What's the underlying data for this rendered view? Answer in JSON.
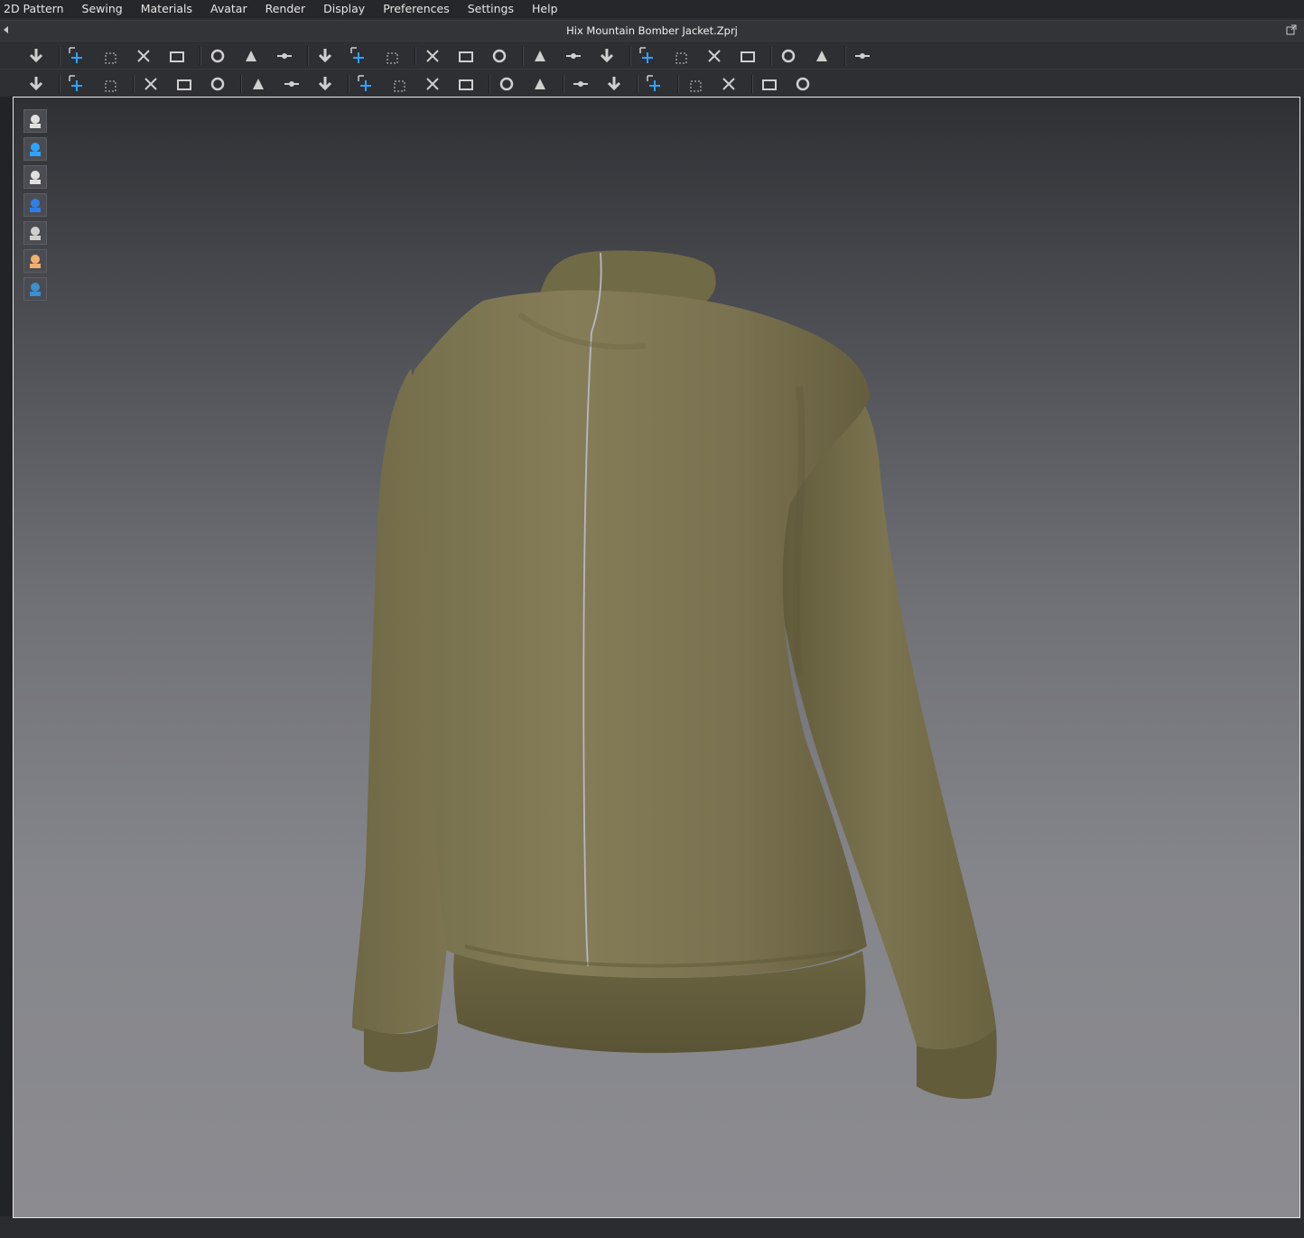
{
  "menu": {
    "items": [
      "2D Pattern",
      "Sewing",
      "Materials",
      "Avatar",
      "Render",
      "Display",
      "Preferences",
      "Settings",
      "Help"
    ]
  },
  "window": {
    "title": "Hix Mountain Bomber Jacket.Zprj"
  },
  "toolbar1": {
    "tools": [
      "simulation-icon",
      "select-move-icon",
      "select-mesh-box-icon",
      "select-mesh-lasso-icon",
      "transform-pattern-icon",
      "fold-arrangement-icon",
      "gather-icon",
      "tuck-icon",
      "pin-icon",
      "strap-icon",
      "garment-fit-icon",
      "fold-flip-icon",
      "fold-3d-icon",
      "avatar-pose-icon",
      "reset-2d-icon",
      "reset-3d-icon",
      "arrange-icon",
      "layer-increase-icon",
      "layer-decrease-icon",
      "pin-box-icon",
      "pin-line-icon",
      "measure-circumference-icon",
      "measure-girth-icon",
      "tape-icon"
    ]
  },
  "toolbar2": {
    "tools": [
      "walk-icon",
      "sewing-segment-icon",
      "sewing-free-icon",
      "steam-icon",
      "pleat-icon",
      "shirring-icon",
      "zipper-icon",
      "puckering-icon",
      "trim-icon",
      "button-icon",
      "button-hole-icon",
      "line-icon",
      "buttonhole-lock-icon",
      "zipper-pull-icon",
      "graphic-icon",
      "texture-icon",
      "texture-transform-icon",
      "topstitch-icon",
      "fold-in-icon",
      "bond-icon",
      "skive-icon",
      "drape-icon"
    ]
  },
  "viewport": {
    "side_tools": [
      "show-garment-icon",
      "show-avatar-fitting-icon",
      "show-avatar-icon",
      "show-fabric-icon",
      "show-texture-icon",
      "show-skin-icon",
      "show-environment-icon"
    ]
  },
  "colors": {
    "garment": "#7f7752",
    "garment_shadow": "#5e5838",
    "viewport_border": "#e9e9e9",
    "accent": "#2ea3ff"
  }
}
